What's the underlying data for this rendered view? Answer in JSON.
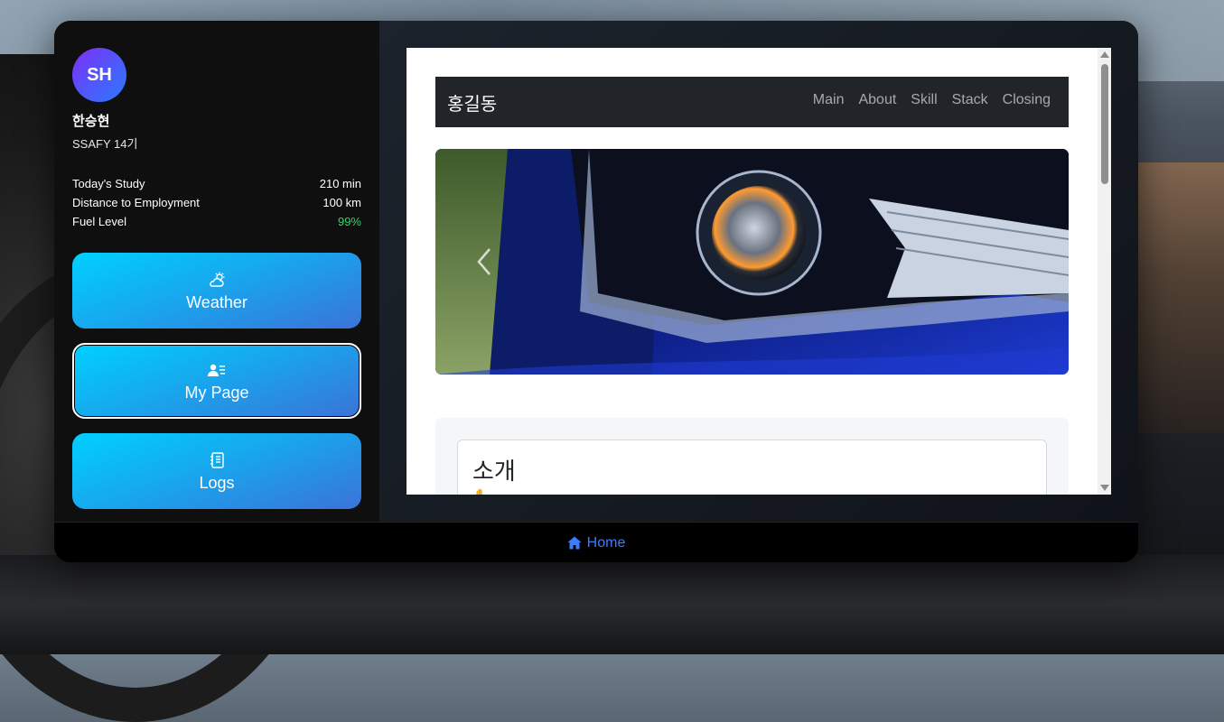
{
  "profile": {
    "initials": "SH",
    "name": "한승현",
    "cohort": "SSAFY 14기"
  },
  "stats": [
    {
      "label": "Today's Study",
      "value": "210 min"
    },
    {
      "label": "Distance to Employment",
      "value": "100 km"
    },
    {
      "label": "Fuel Level",
      "value": "99%",
      "value_color": "#2fd56a"
    }
  ],
  "nav": [
    {
      "label": "Weather",
      "icon": "cloud-sun-icon",
      "active": false
    },
    {
      "label": "My Page",
      "icon": "person-lines-icon",
      "active": true
    },
    {
      "label": "Logs",
      "icon": "journal-icon",
      "active": false
    }
  ],
  "page": {
    "brand": "홍길동",
    "links": [
      "Main",
      "About",
      "Skill",
      "Stack",
      "Closing"
    ],
    "section_title": "소개"
  },
  "footer": {
    "home_label": "Home",
    "home_icon": "house-icon"
  },
  "colors": {
    "accent_gradient_start": "#00d0ff",
    "accent_gradient_end": "#3b73d8",
    "link": "#3d7cff",
    "status_ok": "#2fd56a"
  }
}
